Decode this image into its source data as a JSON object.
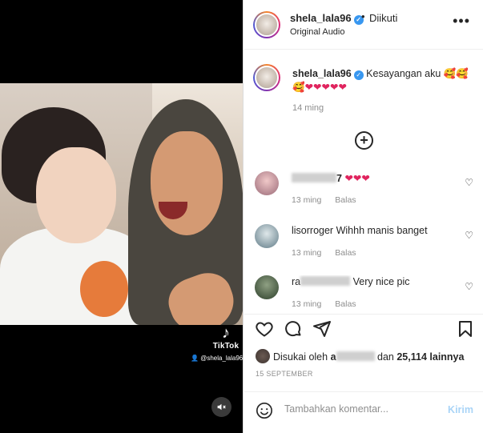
{
  "media": {
    "watermark_brand": "TikTok",
    "watermark_handle": "@shela_lala96",
    "mute_icon": "speaker-muted-icon"
  },
  "header": {
    "username": "shela_lala96",
    "separator": "•",
    "follow_status": "Diikuti",
    "audio": "Original Audio",
    "more_icon": "more-horizontal-icon"
  },
  "caption": {
    "username": "shela_lala96",
    "text": "Kesayangan aku",
    "emoji_line1": "🥰🥰",
    "emoji_line2_face": "🥰",
    "hearts": "❤❤❤❤❤",
    "time": "14 ming"
  },
  "load_more_icon": "plus-circle-icon",
  "comments": [
    {
      "username_visible": "7",
      "text": "❤❤❤",
      "time": "13 ming",
      "reply": "Balas",
      "avatar_color": "#c98a9a"
    },
    {
      "username_visible": "lisorroger",
      "text": "Wihhh manis banget",
      "time": "13 ming",
      "reply": "Balas",
      "avatar_color": "#8aa0a8"
    },
    {
      "username_visible": "ra",
      "text": "Very nice pic",
      "time": "13 ming",
      "reply": "Balas",
      "avatar_color": "#3f5a3a"
    }
  ],
  "actions": {
    "like_icon": "heart-icon",
    "comment_icon": "comment-icon",
    "share_icon": "paper-plane-icon",
    "save_icon": "bookmark-icon"
  },
  "likes": {
    "prefix": "Disukai oleh",
    "first_visible": "a",
    "connector": "dan",
    "count": "25,114",
    "suffix": "lainnya"
  },
  "date": "15 SEPTEMBER",
  "add_comment": {
    "placeholder": "Tambahkan komentar...",
    "submit_label": "Kirim"
  },
  "colors": {
    "verified": "#3897f0",
    "heart": "#e0245e",
    "secondary_text": "#8e8e8e",
    "submit_disabled": "#a9d4f7"
  }
}
